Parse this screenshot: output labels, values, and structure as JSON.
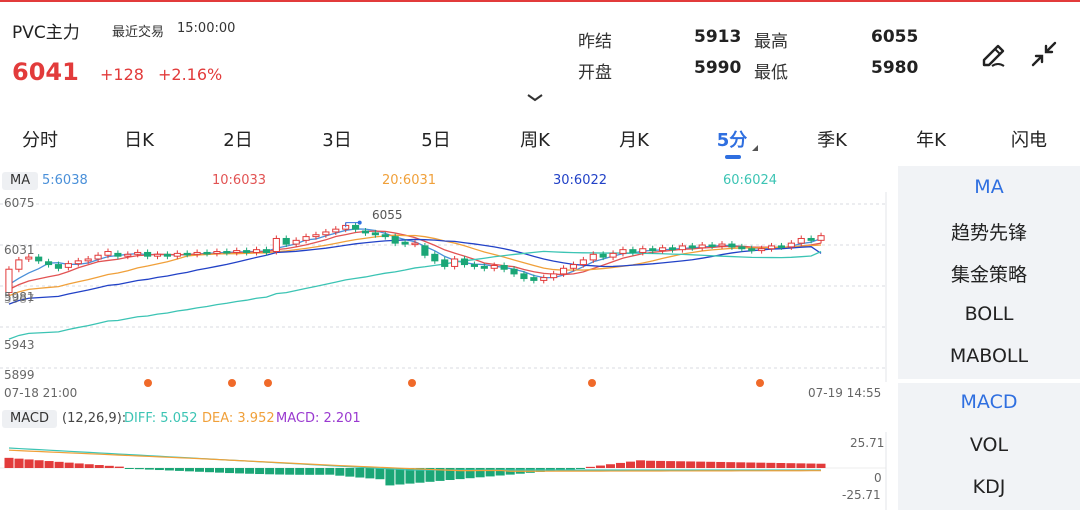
{
  "header": {
    "symbol": "PVC主力",
    "last_trade_label": "最近交易",
    "last_trade_time": "15:00:00",
    "price": "6041",
    "change": "+128",
    "change_pct": "+2.16%",
    "stats": [
      {
        "label": "昨结",
        "value": "5913"
      },
      {
        "label": "最高",
        "value": "6055"
      },
      {
        "label": "开盘",
        "value": "5990"
      },
      {
        "label": "最低",
        "value": "5980"
      }
    ],
    "icons": {
      "draw": "draw-pen-icon",
      "collapse": "collapse-icon",
      "expand": "chevron-down-icon"
    }
  },
  "tabs": [
    {
      "label": "分时"
    },
    {
      "label": "日K"
    },
    {
      "label": "2日"
    },
    {
      "label": "3日"
    },
    {
      "label": "5日"
    },
    {
      "label": "周K"
    },
    {
      "label": "月K"
    },
    {
      "label": "5分"
    },
    {
      "label": "季K"
    },
    {
      "label": "年K"
    },
    {
      "label": "闪电"
    }
  ],
  "active_tab": "5分",
  "ma": {
    "badge": "MA",
    "values": [
      {
        "text": "5:6038",
        "color": "#4a90d9"
      },
      {
        "text": "10:6033",
        "color": "#e25353"
      },
      {
        "text": "20:6031",
        "color": "#f0a03a"
      },
      {
        "text": "30:6022",
        "color": "#2242c7"
      },
      {
        "text": "60:6024",
        "color": "#3cc4b4"
      }
    ]
  },
  "price_axis": {
    "labels": [
      "6075",
      "6031",
      "5981",
      "5943",
      "5899"
    ],
    "overlap_label": "5987",
    "high_marker": "6055"
  },
  "time_axis": {
    "start": "07-18 21:00",
    "end": "07-19 14:55"
  },
  "macd": {
    "badge": "MACD",
    "params": "(12,26,9):",
    "diff": "DIFF: 5.052",
    "dea": "DEA: 3.952",
    "macd": "MACD: 2.201",
    "colors": {
      "diff": "#3cc4b4",
      "dea": "#f0a03a",
      "macd": "#9a3ad0"
    },
    "axis": [
      "25.71",
      "0",
      "-25.71"
    ]
  },
  "side_menu": {
    "items": [
      "MA",
      "趋势先锋",
      "集金策略",
      "BOLL",
      "MABOLL",
      "MACD",
      "VOL",
      "KDJ"
    ],
    "active": [
      "MA",
      "MACD"
    ]
  },
  "colors": {
    "up": "#e23b3b",
    "down": "#1aa676",
    "accent": "#2f6fe0"
  },
  "chart_data": {
    "type": "line",
    "x_start": "07-18 21:00",
    "x_end": "07-19 14:55",
    "y_ticks": [
      6075,
      6031,
      5987,
      5943,
      5899
    ],
    "ylim": [
      5899,
      6075
    ],
    "high": 6055,
    "candles": [
      {
        "o": 5980,
        "c": 6005
      },
      {
        "o": 6005,
        "c": 6015
      },
      {
        "o": 6016,
        "c": 6018
      },
      {
        "o": 6018,
        "c": 6014
      },
      {
        "o": 6013,
        "c": 6010
      },
      {
        "o": 6010,
        "c": 6006
      },
      {
        "o": 6007,
        "c": 6011
      },
      {
        "o": 6011,
        "c": 6014
      },
      {
        "o": 6014,
        "c": 6016
      },
      {
        "o": 6016,
        "c": 6020
      },
      {
        "o": 6020,
        "c": 6024
      },
      {
        "o": 6022,
        "c": 6019
      },
      {
        "o": 6019,
        "c": 6021
      },
      {
        "o": 6021,
        "c": 6023
      },
      {
        "o": 6023,
        "c": 6019
      },
      {
        "o": 6019,
        "c": 6021
      },
      {
        "o": 6021,
        "c": 6019
      },
      {
        "o": 6019,
        "c": 6022
      },
      {
        "o": 6022,
        "c": 6021
      },
      {
        "o": 6021,
        "c": 6023
      },
      {
        "o": 6023,
        "c": 6022
      },
      {
        "o": 6022,
        "c": 6024
      },
      {
        "o": 6024,
        "c": 6023
      },
      {
        "o": 6023,
        "c": 6025
      },
      {
        "o": 6025,
        "c": 6023
      },
      {
        "o": 6023,
        "c": 6026
      },
      {
        "o": 6026,
        "c": 6023
      },
      {
        "o": 6024,
        "c": 6038
      },
      {
        "o": 6038,
        "c": 6032
      },
      {
        "o": 6032,
        "c": 6036
      },
      {
        "o": 6036,
        "c": 6040
      },
      {
        "o": 6040,
        "c": 6042
      },
      {
        "o": 6042,
        "c": 6045
      },
      {
        "o": 6045,
        "c": 6048
      },
      {
        "o": 6048,
        "c": 6052
      },
      {
        "o": 6052,
        "c": 6048
      },
      {
        "o": 6046,
        "c": 6044
      },
      {
        "o": 6044,
        "c": 6042
      },
      {
        "o": 6042,
        "c": 6040
      },
      {
        "o": 6040,
        "c": 6033
      },
      {
        "o": 6034,
        "c": 6032
      },
      {
        "o": 6032,
        "c": 6033
      },
      {
        "o": 6030,
        "c": 6020
      },
      {
        "o": 6021,
        "c": 6014
      },
      {
        "o": 6015,
        "c": 6008
      },
      {
        "o": 6008,
        "c": 6016
      },
      {
        "o": 6016,
        "c": 6010
      },
      {
        "o": 6010,
        "c": 6008
      },
      {
        "o": 6008,
        "c": 6006
      },
      {
        "o": 6006,
        "c": 6009
      },
      {
        "o": 6009,
        "c": 6005
      },
      {
        "o": 6005,
        "c": 6000
      },
      {
        "o": 6000,
        "c": 5995
      },
      {
        "o": 5996,
        "c": 5993
      },
      {
        "o": 5993,
        "c": 5996
      },
      {
        "o": 5996,
        "c": 6000
      },
      {
        "o": 6000,
        "c": 6006
      },
      {
        "o": 6006,
        "c": 6010
      },
      {
        "o": 6010,
        "c": 6015
      },
      {
        "o": 6015,
        "c": 6021
      },
      {
        "o": 6021,
        "c": 6018
      },
      {
        "o": 6018,
        "c": 6022
      },
      {
        "o": 6022,
        "c": 6026
      },
      {
        "o": 6026,
        "c": 6023
      },
      {
        "o": 6023,
        "c": 6027
      },
      {
        "o": 6027,
        "c": 6025
      },
      {
        "o": 6025,
        "c": 6028
      },
      {
        "o": 6028,
        "c": 6026
      },
      {
        "o": 6026,
        "c": 6030
      },
      {
        "o": 6030,
        "c": 6028
      },
      {
        "o": 6028,
        "c": 6031
      },
      {
        "o": 6031,
        "c": 6030
      },
      {
        "o": 6030,
        "c": 6032
      },
      {
        "o": 6032,
        "c": 6029
      },
      {
        "o": 6029,
        "c": 6027
      },
      {
        "o": 6027,
        "c": 6025
      },
      {
        "o": 6025,
        "c": 6027
      },
      {
        "o": 6027,
        "c": 6030
      },
      {
        "o": 6030,
        "c": 6029
      },
      {
        "o": 6029,
        "c": 6033
      },
      {
        "o": 6033,
        "c": 6038
      },
      {
        "o": 6038,
        "c": 6036
      },
      {
        "o": 6036,
        "c": 6041
      }
    ],
    "ma_series": [
      {
        "name": "5",
        "color": "#4a90d9",
        "start": 5983,
        "end": 6038
      },
      {
        "name": "10",
        "color": "#e25353",
        "start": 5976,
        "end": 6033
      },
      {
        "name": "20",
        "color": "#f0a03a",
        "start": 5967,
        "end": 6031
      },
      {
        "name": "30",
        "color": "#2242c7",
        "start": 5955,
        "end": 6022
      },
      {
        "name": "60",
        "color": "#3cc4b4",
        "start": 5905,
        "end": 6024
      }
    ],
    "event_markers": 6
  }
}
